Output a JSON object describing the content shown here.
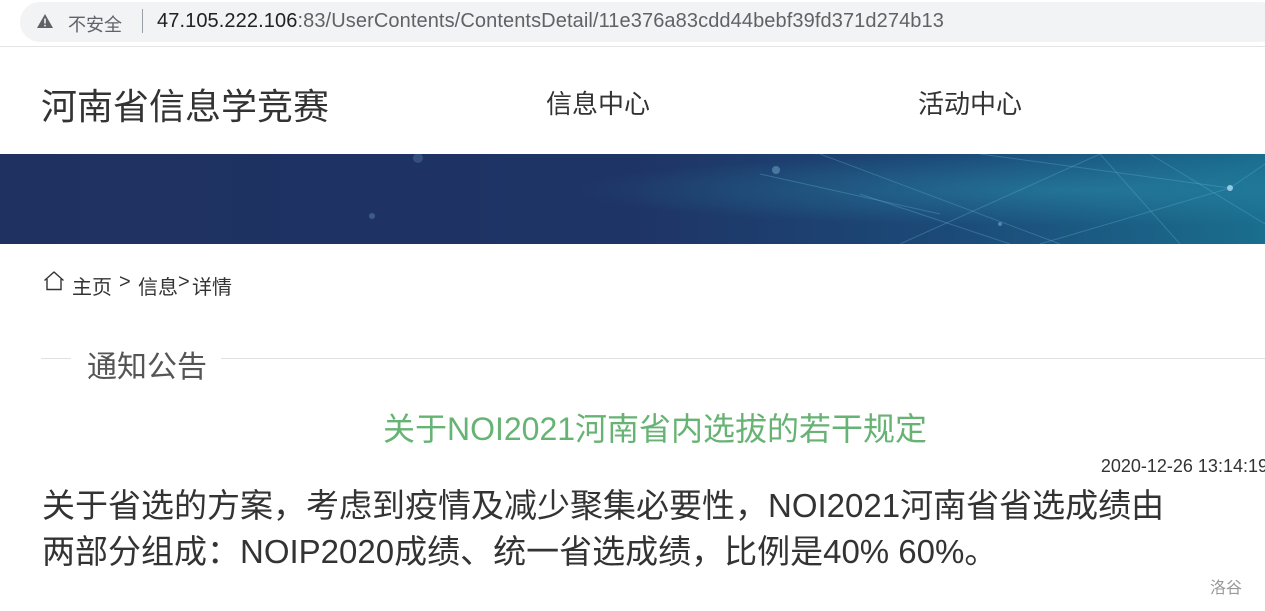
{
  "browser": {
    "security_label": "不安全",
    "url_host": "47.105.222.106",
    "url_rest": ":83/UserContents/ContentsDetail/11e376a83cdd44bebf39fd371d274b13"
  },
  "header": {
    "site_title": "河南省信息学竞赛",
    "nav": [
      "信息中心",
      "活动中心"
    ]
  },
  "breadcrumb": {
    "home": "主页",
    "sep1": ">",
    "info": "信息",
    "sep2": ">",
    "detail": "详情"
  },
  "section": {
    "title": "通知公告"
  },
  "article": {
    "title": "关于NOI2021河南省内选拔的若干规定",
    "date": "2020-12-26 13:14:19",
    "body_lines": [
      "关于省选的方案，考虑到疫情及减少聚集必要性，NOI2021河南省省选成绩由",
      "两部分组成：NOIP2020成绩、统一省选成绩，比例是40% 60%。"
    ]
  },
  "watermark": "洛谷",
  "colors": {
    "title_green": "#67b374",
    "banner_dark": "#1e2e5c",
    "banner_teal": "#1a6a8a"
  }
}
